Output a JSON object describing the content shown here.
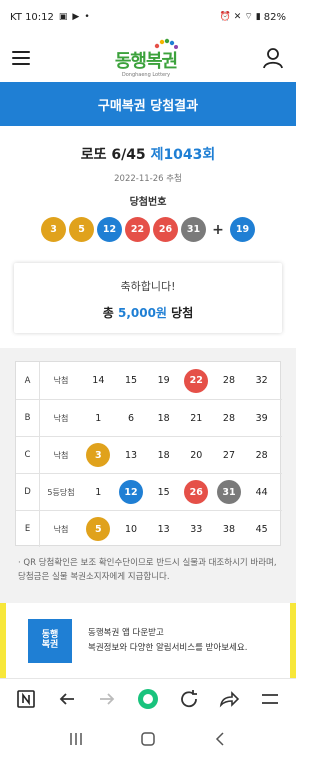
{
  "status_bar": {
    "carrier_time": "KT 10:12",
    "battery": "82%"
  },
  "header": {
    "logo_text": "동행복권",
    "logo_sub": "Donghaeng Lottery"
  },
  "page_title": "구매복권 당첨결과",
  "draw": {
    "game": "로또 6/45",
    "round": "제1043회",
    "date": "2022-11-26 추첨"
  },
  "winning": {
    "label": "당첨번호",
    "numbers": [
      3,
      5,
      12,
      22,
      26,
      31
    ],
    "bonus": 19,
    "plus": "+"
  },
  "result": {
    "message": "축하합니다!",
    "prefix": "총",
    "amount": "5,000원",
    "suffix": "당첨"
  },
  "ticket_rows": [
    {
      "label": "A",
      "status": "낙첨",
      "numbers": [
        "14",
        "15",
        "19",
        "22",
        "28",
        "32"
      ]
    },
    {
      "label": "B",
      "status": "낙첨",
      "numbers": [
        "1",
        "6",
        "18",
        "21",
        "28",
        "39"
      ]
    },
    {
      "label": "C",
      "status": "낙첨",
      "numbers": [
        "3",
        "13",
        "18",
        "20",
        "27",
        "28"
      ]
    },
    {
      "label": "D",
      "status": "5등당첨",
      "numbers": [
        "1",
        "12",
        "15",
        "26",
        "31",
        "44"
      ]
    },
    {
      "label": "E",
      "status": "낙첨",
      "numbers": [
        "5",
        "10",
        "13",
        "33",
        "38",
        "45"
      ]
    }
  ],
  "notice": {
    "line1": "· QR 당첨확인은 보조 확인수단이므로 반드시 실물과 대조하시기 바라며,",
    "line2": "당첨금은 실물 복권소지자에게 지급합니다."
  },
  "banner": {
    "icon_line1": "동행",
    "icon_line2": "복권",
    "text1": "동행복권 앱 다운받고",
    "text2": "복권정보와 다양한 알림서비스를 받아보세요."
  },
  "colors": {
    "primary": "#1f7fd4",
    "ball_yellow": "#e0a21c",
    "ball_blue": "#1f7fd4",
    "ball_red": "#e55048",
    "ball_gray": "#7a7a7a",
    "banner_yellow": "#f7e73a"
  }
}
